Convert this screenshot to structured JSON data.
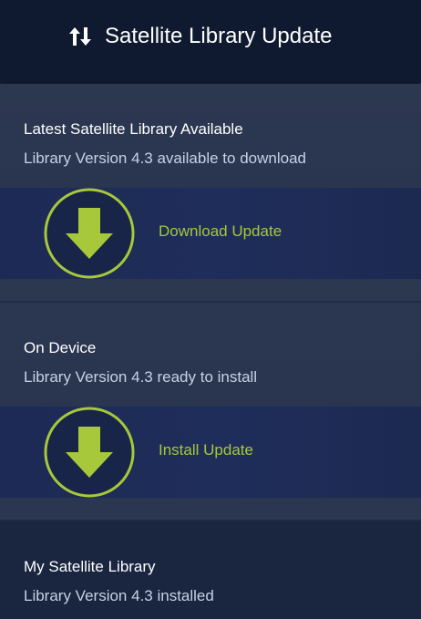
{
  "header": {
    "title": "Satellite Library Update",
    "icon": "swap-arrows-icon"
  },
  "sections": [
    {
      "heading": "Latest Satellite Library Available",
      "subtitle": "Library Version 4.3 available to download",
      "action_label": "Download Update",
      "action_icon": "download-arrow-icon"
    },
    {
      "heading": "On Device",
      "subtitle": "Library Version 4.3 ready to install",
      "action_label": "Install Update",
      "action_icon": "download-arrow-icon"
    },
    {
      "heading": "My Satellite Library",
      "subtitle": "Library Version 4.3 installed"
    }
  ],
  "colors": {
    "accent": "#a6c83a",
    "header_bg": "#0f1a30",
    "text": "#ffffff",
    "subtext": "#c7d2e6"
  }
}
